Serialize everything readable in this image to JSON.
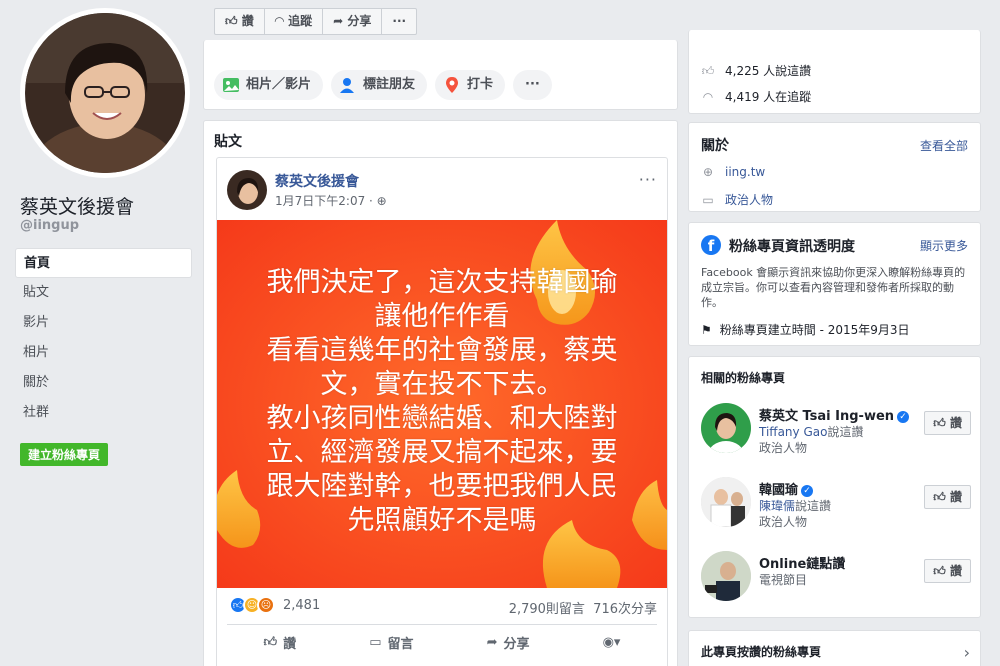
{
  "sidebar": {
    "page_name": "蔡英文後援會",
    "handle": "@iingup",
    "nav": [
      "首頁",
      "貼文",
      "影片",
      "相片",
      "關於",
      "社群"
    ],
    "create_button": "建立粉絲專頁"
  },
  "action_bar": {
    "like": "讚",
    "follow": "追蹤",
    "share": "分享",
    "more": "···"
  },
  "composer": {
    "photo_video": "相片／影片",
    "tag_friends": "標註朋友",
    "check_in": "打卡",
    "more": "···"
  },
  "posts": {
    "section_title": "貼文",
    "post": {
      "author": "蔡英文後援會",
      "time": "1月7日下午2:07 · ",
      "image_text": [
        "我們決定了，這次支持韓國瑜",
        "讓他作作看",
        "看看這幾年的社會發展，蔡英",
        "文，實在投不下去。",
        "教小孩同性戀結婚、和大陸對",
        "立、經濟發展又搞不起來，要",
        "跟大陸對幹，也要把我們人民",
        "先照顧好不是嗎"
      ],
      "reaction_count": "2,481",
      "comments": "2,790則留言",
      "shares": "716次分享",
      "actions": {
        "like": "讚",
        "comment": "留言",
        "share": "分享"
      }
    }
  },
  "right": {
    "top": {
      "likes": "4,225 人說這讚",
      "follows": "4,419 人在追蹤"
    },
    "about": {
      "title": "關於",
      "see_all": "查看全部",
      "website": "iing.tw",
      "category": "政治人物"
    },
    "transparency": {
      "title": "粉絲專頁資訊透明度",
      "show_more": "顯示更多",
      "description": "Facebook 會顯示資訊來協助你更深入瞭解粉絲專頁的成立宗旨。你可以查看內容管理和發佈者所採取的動作。",
      "created": "粉絲專頁建立時間 - 2015年9月3日"
    },
    "related": {
      "title": "相關的粉絲專頁",
      "items": [
        {
          "name": "蔡英文 Tsai Ing-wen",
          "liker": "Tiffany Gao",
          "liker_suffix": "說這讚",
          "category": "政治人物",
          "button": "讚"
        },
        {
          "name": "韓國瑜",
          "liker": "陳瑋儒",
          "liker_suffix": "說這讚",
          "category": "政治人物",
          "button": "讚"
        },
        {
          "name": "Online鏈點讚",
          "liker": "",
          "liker_suffix": "",
          "category": "電視節目",
          "button": "讚"
        }
      ]
    },
    "liked_pages": {
      "title": "此專頁按讚的粉絲專頁"
    }
  },
  "colors": {
    "fb_blue": "#1877f2",
    "link": "#385898",
    "green": "#42b72a",
    "post_bg": "#fc4a1f"
  }
}
